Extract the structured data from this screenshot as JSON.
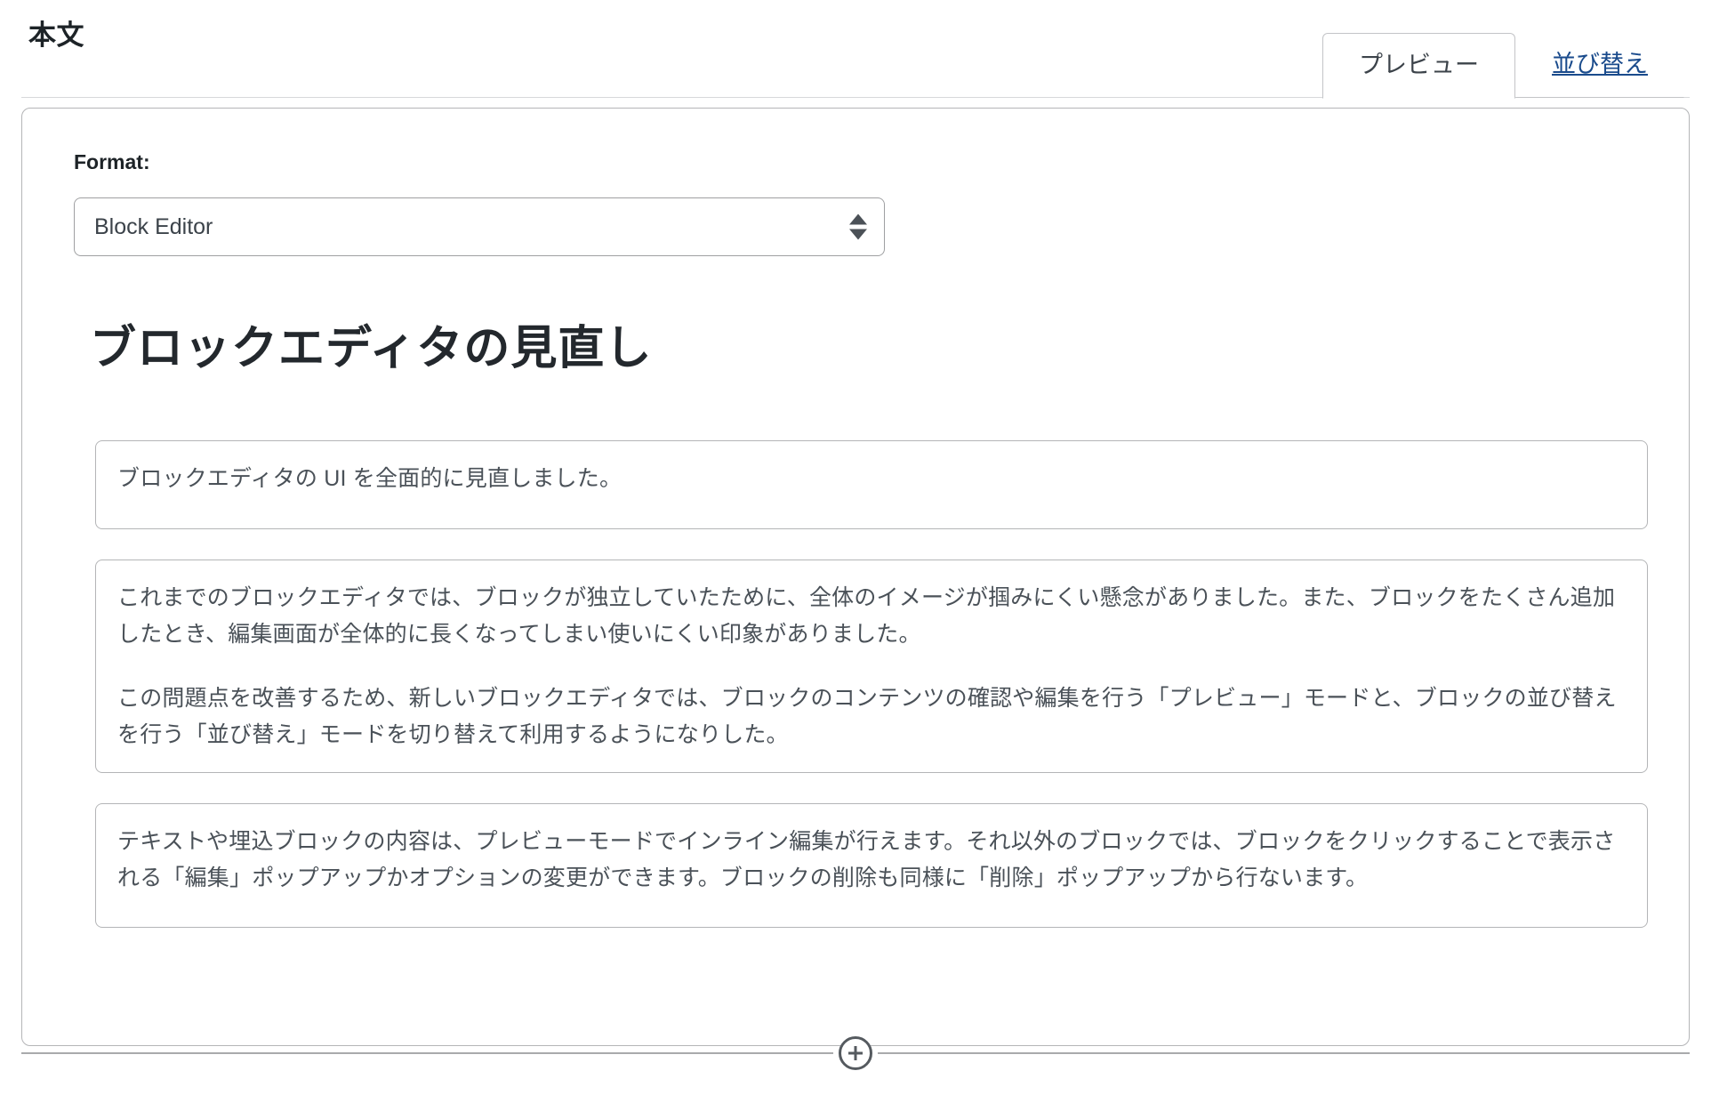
{
  "header": {
    "title": "本文",
    "tabs": [
      {
        "label": "プレビュー",
        "state": "active"
      },
      {
        "label": "並び替え",
        "state": "inactive"
      }
    ]
  },
  "format": {
    "label": "Format:",
    "selected": "Block Editor",
    "options": [
      "Block Editor"
    ]
  },
  "document": {
    "heading": "ブロックエディタの見直し",
    "blocks": [
      {
        "type": "text",
        "paragraphs": [
          "ブロックエディタの UI を全面的に見直しました。"
        ]
      },
      {
        "type": "text",
        "paragraphs": [
          "これまでのブロックエディタでは、ブロックが独立していたために、全体のイメージが掴みにくい懸念がありました。また、ブロックをたくさん追加したとき、編集画面が全体的に長くなってしまい使いにくい印象がありました。",
          "この問題点を改善するため、新しいブロックエディタでは、ブロックのコンテンツの確認や編集を行う「プレビュー」モードと、ブロックの並び替えを行う「並び替え」モードを切り替えて利用するようになりした。"
        ]
      },
      {
        "type": "text",
        "paragraphs": [
          "テキストや埋込ブロックの内容は、プレビューモードでインライン編集が行えます。それ以外のブロックでは、ブロックをクリックすることで表示される「編集」ポップアップかオプションの変更ができます。ブロックの削除も同様に「削除」ポップアップから行ないます。"
        ]
      }
    ]
  },
  "footer": {
    "add_block_icon": "plus-circle-icon"
  },
  "colors": {
    "link": "#1a4b8c",
    "text": "#4a5158",
    "heading": "#23282d",
    "border": "#b4b5b7",
    "rule": "#a9aaac"
  }
}
